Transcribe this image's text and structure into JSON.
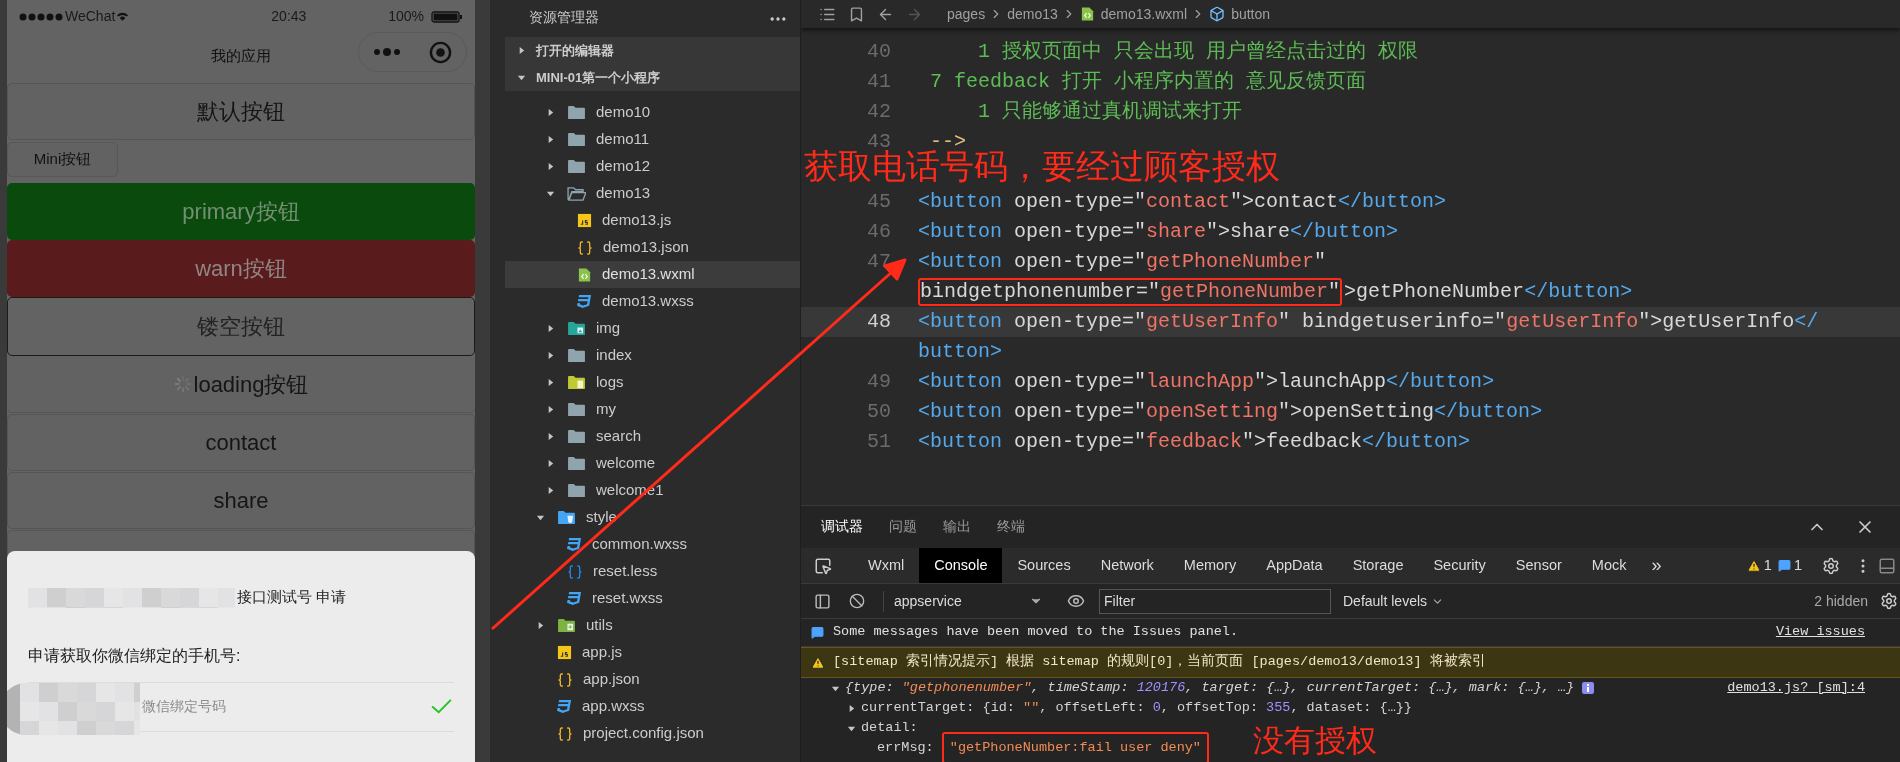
{
  "phone": {
    "status_bar": {
      "carrier": "WeChat",
      "time": "20:43",
      "battery": "100%"
    },
    "nav_title": "我的应用",
    "buttons": [
      {
        "kind": "default",
        "label": "默认按钮"
      },
      {
        "kind": "mini",
        "label": "Mini按钮"
      },
      {
        "kind": "primary",
        "label": "primary按钮"
      },
      {
        "kind": "warn",
        "label": "warn按钮"
      },
      {
        "kind": "plain",
        "label": "镂空按钮"
      },
      {
        "kind": "loading",
        "label": "loading按钮"
      },
      {
        "kind": "default",
        "label": "contact"
      },
      {
        "kind": "default",
        "label": "share"
      },
      {
        "kind": "default"
      }
    ],
    "dialog": {
      "title": "接口测试号 申请",
      "message": "申请获取你微信绑定的手机号:",
      "option": "微信绑定号码",
      "option_checked": true
    }
  },
  "explorer": {
    "title": "资源管理器",
    "sections": [
      {
        "label": "打开的编辑器",
        "expanded": false
      },
      {
        "label": "MINI-01第一个小程序",
        "expanded": true,
        "children": [
          {
            "kind": "group",
            "children": [
              {
                "kind": "folder",
                "label": "demo10",
                "expanded": false
              },
              {
                "kind": "folder",
                "label": "demo11",
                "expanded": false
              },
              {
                "kind": "folder",
                "label": "demo12",
                "expanded": false
              },
              {
                "kind": "folder",
                "label": "demo13",
                "expanded": true,
                "children": [
                  {
                    "kind": "js-file",
                    "label": "demo13.js",
                    "selected": false
                  },
                  {
                    "kind": "json-file",
                    "label": "demo13.json",
                    "selected": false
                  },
                  {
                    "kind": "wxml-file",
                    "label": "demo13.wxml",
                    "selected": true
                  },
                  {
                    "kind": "css-file",
                    "label": "demo13.wxss",
                    "selected": false
                  }
                ]
              },
              {
                "kind": "image-folder",
                "label": "img",
                "expanded": false
              },
              {
                "kind": "folder",
                "label": "index",
                "expanded": false
              },
              {
                "kind": "logs-folder",
                "label": "logs",
                "expanded": false
              },
              {
                "kind": "folder",
                "label": "my",
                "expanded": false
              },
              {
                "kind": "folder",
                "label": "search",
                "expanded": false
              },
              {
                "kind": "folder",
                "label": "welcome",
                "expanded": false
              },
              {
                "kind": "folder",
                "label": "welcome1",
                "expanded": false
              }
            ]
          },
          {
            "kind": "style-folder",
            "label": "style",
            "expanded": true,
            "children": [
              {
                "kind": "css-file",
                "label": "common.wxss",
                "selected": false
              },
              {
                "kind": "less-file",
                "label": "reset.less",
                "selected": false
              },
              {
                "kind": "css-file",
                "label": "reset.wxss",
                "selected": false
              }
            ]
          },
          {
            "kind": "utils-folder",
            "label": "utils",
            "expanded": false
          },
          {
            "kind": "js-file",
            "label": "app.js",
            "selected": false
          },
          {
            "kind": "json-file",
            "label": "app.json",
            "selected": false
          },
          {
            "kind": "css-file",
            "label": "app.wxss",
            "selected": false
          },
          {
            "kind": "json-file",
            "label": "project.config.json",
            "selected": false
          }
        ]
      }
    ]
  },
  "editor": {
    "breadcrumb": [
      {
        "kind": "folder",
        "label": "pages"
      },
      {
        "kind": "folder",
        "label": "demo13"
      },
      {
        "kind": "file",
        "label": "demo13.wxml"
      },
      {
        "kind": "element",
        "label": "button"
      }
    ],
    "annotation": "获取电话号码，要经过顾客授权",
    "lines": [
      {
        "number": "40",
        "current": false,
        "tokens": [
          {
            "kind": "comment",
            "text": "     1 授权页面中 只会出现 用户曾经点击过的 权限"
          }
        ]
      },
      {
        "number": "41",
        "current": false,
        "tokens": [
          {
            "kind": "comment",
            "text": " 7 feedback 打开 小程序内置的 意见反馈页面"
          }
        ]
      },
      {
        "number": "42",
        "current": false,
        "tokens": [
          {
            "kind": "comment",
            "text": "     1 只能够通过真机调试来打开"
          }
        ]
      },
      {
        "number": "43",
        "current": false,
        "tokens": [
          {
            "kind": "comment-end",
            "text": " -->"
          }
        ]
      },
      {
        "current": false
      },
      {
        "number": "45",
        "current": false,
        "tokens": [
          {
            "kind": "tag",
            "text": "<button"
          },
          {
            "kind": "attr",
            "text": " open-type=\""
          },
          {
            "kind": "string",
            "text": "contact"
          },
          {
            "kind": "attr",
            "text": "\">contact"
          },
          {
            "kind": "tag",
            "text": "</button>"
          }
        ]
      },
      {
        "number": "46",
        "current": false,
        "tokens": [
          {
            "kind": "tag",
            "text": "<button"
          },
          {
            "kind": "attr",
            "text": " open-type=\""
          },
          {
            "kind": "string",
            "text": "share"
          },
          {
            "kind": "attr",
            "text": "\">share"
          },
          {
            "kind": "tag",
            "text": "</button>"
          }
        ]
      },
      {
        "number": "47",
        "current": false,
        "tokens": [
          {
            "kind": "tag",
            "text": "<button"
          },
          {
            "kind": "attr",
            "text": " open-type=\""
          },
          {
            "kind": "string",
            "text": "getPhoneNumber"
          },
          {
            "kind": "attr",
            "text": "\""
          }
        ]
      },
      {
        "current": false,
        "tokens": [
          {
            "kind": "attr",
            "text": "bindgetphonenumber=\"",
            "boxed": true
          },
          {
            "kind": "string",
            "text": "getPhoneNumber",
            "boxed": true
          },
          {
            "kind": "attr",
            "text": "\"",
            "boxed": true
          },
          {
            "kind": "attr",
            "text": ">getPhoneNumber",
            "boxed": false
          },
          {
            "kind": "tag",
            "text": "</button>",
            "boxed": false
          }
        ]
      },
      {
        "number": "48",
        "current": true,
        "tokens": [
          {
            "kind": "tag",
            "text": "<button"
          },
          {
            "kind": "attr",
            "text": " open-type=\""
          },
          {
            "kind": "string",
            "text": "getUserInfo"
          },
          {
            "kind": "attr",
            "text": "\" bindgetuserinfo=\""
          },
          {
            "kind": "string",
            "text": "getUserInfo"
          },
          {
            "kind": "attr",
            "text": "\">getUserInfo"
          },
          {
            "kind": "tag",
            "text": "</"
          }
        ]
      },
      {
        "current": false,
        "tokens": [
          {
            "kind": "tag",
            "text": "button>"
          }
        ]
      },
      {
        "number": "49",
        "current": false,
        "tokens": [
          {
            "kind": "tag",
            "text": "<button"
          },
          {
            "kind": "attr",
            "text": " open-type=\""
          },
          {
            "kind": "string",
            "text": "launchApp"
          },
          {
            "kind": "attr",
            "text": "\">launchApp"
          },
          {
            "kind": "tag",
            "text": "</button>"
          }
        ]
      },
      {
        "number": "50",
        "current": false,
        "tokens": [
          {
            "kind": "tag",
            "text": "<button"
          },
          {
            "kind": "attr",
            "text": " open-type=\""
          },
          {
            "kind": "string",
            "text": "openSetting"
          },
          {
            "kind": "attr",
            "text": "\">openSetting"
          },
          {
            "kind": "tag",
            "text": "</button>"
          }
        ]
      },
      {
        "number": "51",
        "current": false,
        "tokens": [
          {
            "kind": "tag",
            "text": "<button"
          },
          {
            "kind": "attr",
            "text": " open-type=\""
          },
          {
            "kind": "string",
            "text": "feedback"
          },
          {
            "kind": "attr",
            "text": "\">feedback"
          },
          {
            "kind": "tag",
            "text": "</button>"
          }
        ]
      }
    ]
  },
  "devtools": {
    "panel_tabs": [
      {
        "label": "调试器",
        "selected": true
      },
      {
        "label": "问题",
        "selected": false
      },
      {
        "label": "输出",
        "selected": false
      },
      {
        "label": "终端",
        "selected": false
      }
    ],
    "tool_tabs": [
      {
        "label": "Wxml",
        "selected": false
      },
      {
        "label": "Console",
        "selected": true
      },
      {
        "label": "Sources",
        "selected": false
      },
      {
        "label": "Network",
        "selected": false
      },
      {
        "label": "Memory",
        "selected": false
      },
      {
        "label": "AppData",
        "selected": false
      },
      {
        "label": "Storage",
        "selected": false
      },
      {
        "label": "Security",
        "selected": false
      },
      {
        "label": "Sensor",
        "selected": false
      },
      {
        "label": "Mock",
        "selected": false
      }
    ],
    "more_tabs": "»",
    "warning_count": "1",
    "message_count": "1",
    "context": "appservice",
    "filter_placeholder": "Filter",
    "levels": "Default levels",
    "hidden": "2 hidden",
    "annotation": "没有授权",
    "console": [
      {
        "kind": "info",
        "text": "Some messages have been moved to the Issues panel.",
        "link": "View issues"
      },
      {
        "kind": "warning",
        "text": "[sitemap 索引情况提示] 根据 sitemap 的规则[0]，当前页面 [pages/demo13/demo13] 将被索引"
      },
      {
        "kind": "object",
        "expanded": true,
        "source": "demo13.js? [sm]:4",
        "tokens": [
          {
            "kind": "punct",
            "text": "{type: "
          },
          {
            "kind": "string",
            "text": "\"getphonenumber\""
          },
          {
            "kind": "punct",
            "text": ", timeStamp: "
          },
          {
            "kind": "number",
            "text": "120176"
          },
          {
            "kind": "punct",
            "text": ", target: {…}, currentTarget: {…}, mark: {…}, …}"
          }
        ],
        "children": [
          {
            "kind": "property",
            "expanded": false,
            "tokens": [
              {
                "kind": "key",
                "text": "currentTarget"
              },
              {
                "kind": "punct",
                "text": ": {id: "
              },
              {
                "kind": "string",
                "text": "\"\""
              },
              {
                "kind": "punct",
                "text": ", offsetLeft: "
              },
              {
                "kind": "number",
                "text": "0"
              },
              {
                "kind": "punct",
                "text": ", offsetTop: "
              },
              {
                "kind": "number",
                "text": "355"
              },
              {
                "kind": "punct",
                "text": ", dataset: {…}}"
              }
            ]
          },
          {
            "kind": "property",
            "expanded": true,
            "tokens": [
              {
                "kind": "key",
                "text": "detail:"
              }
            ],
            "children": [
              {
                "kind": "leaf",
                "tokens": [
                  {
                    "kind": "key",
                    "text": "errMsg: ",
                    "boxed": false
                  },
                  {
                    "kind": "string",
                    "text": "\"getPhoneNumber:fail user deny\"",
                    "boxed": true
                  }
                ]
              }
            ]
          }
        ]
      }
    ]
  }
}
